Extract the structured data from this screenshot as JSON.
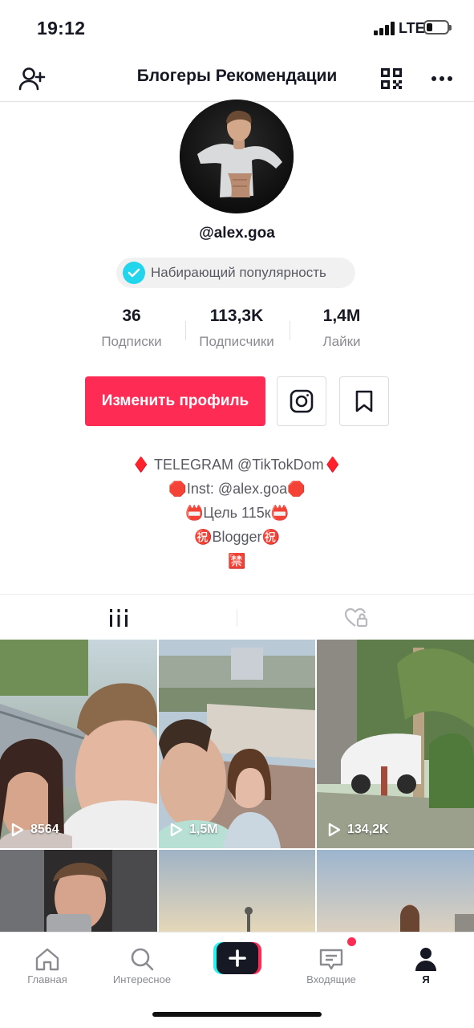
{
  "status": {
    "time": "19:12",
    "network": "LTE",
    "battery_level": 0.3
  },
  "header": {
    "title": "Блогеры Рекомендации"
  },
  "profile": {
    "username": "@alex.goa",
    "badge": "Набирающий популярность",
    "stats": [
      {
        "value": "36",
        "label": "Подписки"
      },
      {
        "value": "113,3K",
        "label": "Подписчики"
      },
      {
        "value": "1,4M",
        "label": "Лайки"
      }
    ],
    "edit_button": "Изменить профиль",
    "bio": [
      {
        "left": "♦️",
        "text": " TELEGRAM @TikTokDom",
        "right": "♦️"
      },
      {
        "left": "🛑",
        "text": "Inst: @alex.goa",
        "right": "🛑"
      },
      {
        "left": "📛",
        "text": "Цель 115к",
        "right": "📛"
      },
      {
        "left": "㊗️",
        "text": "Blogger",
        "right": "㊗️"
      },
      {
        "left": "🈲",
        "text": "",
        "right": ""
      }
    ]
  },
  "videos": [
    {
      "views": "8564"
    },
    {
      "views": "1,5M"
    },
    {
      "views": "134,2K"
    }
  ],
  "tabbar": {
    "home": "Главная",
    "discover": "Интересное",
    "inbox": "Входящие",
    "me": "Я"
  },
  "colors": {
    "accent": "#fe2c55",
    "verified": "#20d5ec",
    "text": "#161823",
    "secondary": "#8a8b91"
  }
}
